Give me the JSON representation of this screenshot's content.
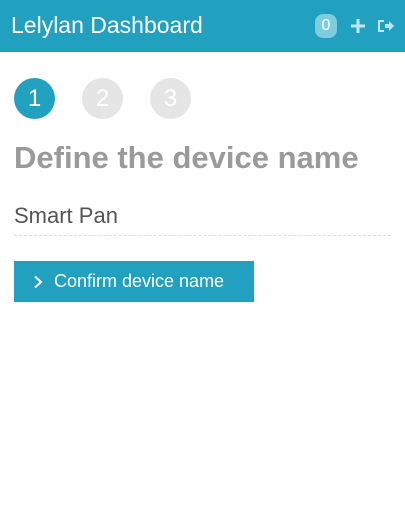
{
  "header": {
    "title": "Lelylan Dashboard",
    "notification_count": "0",
    "add_icon": "plus-icon",
    "logout_icon": "sign-out-icon",
    "color": "#22a0c0"
  },
  "steps": [
    {
      "label": "1",
      "state": "active"
    },
    {
      "label": "2",
      "state": "inactive"
    },
    {
      "label": "3",
      "state": "inactive"
    }
  ],
  "main": {
    "title": "Define the device name",
    "device_name_value": "Smart Pan",
    "confirm_label": "Confirm device name",
    "confirm_icon": "chevron-right-icon"
  }
}
